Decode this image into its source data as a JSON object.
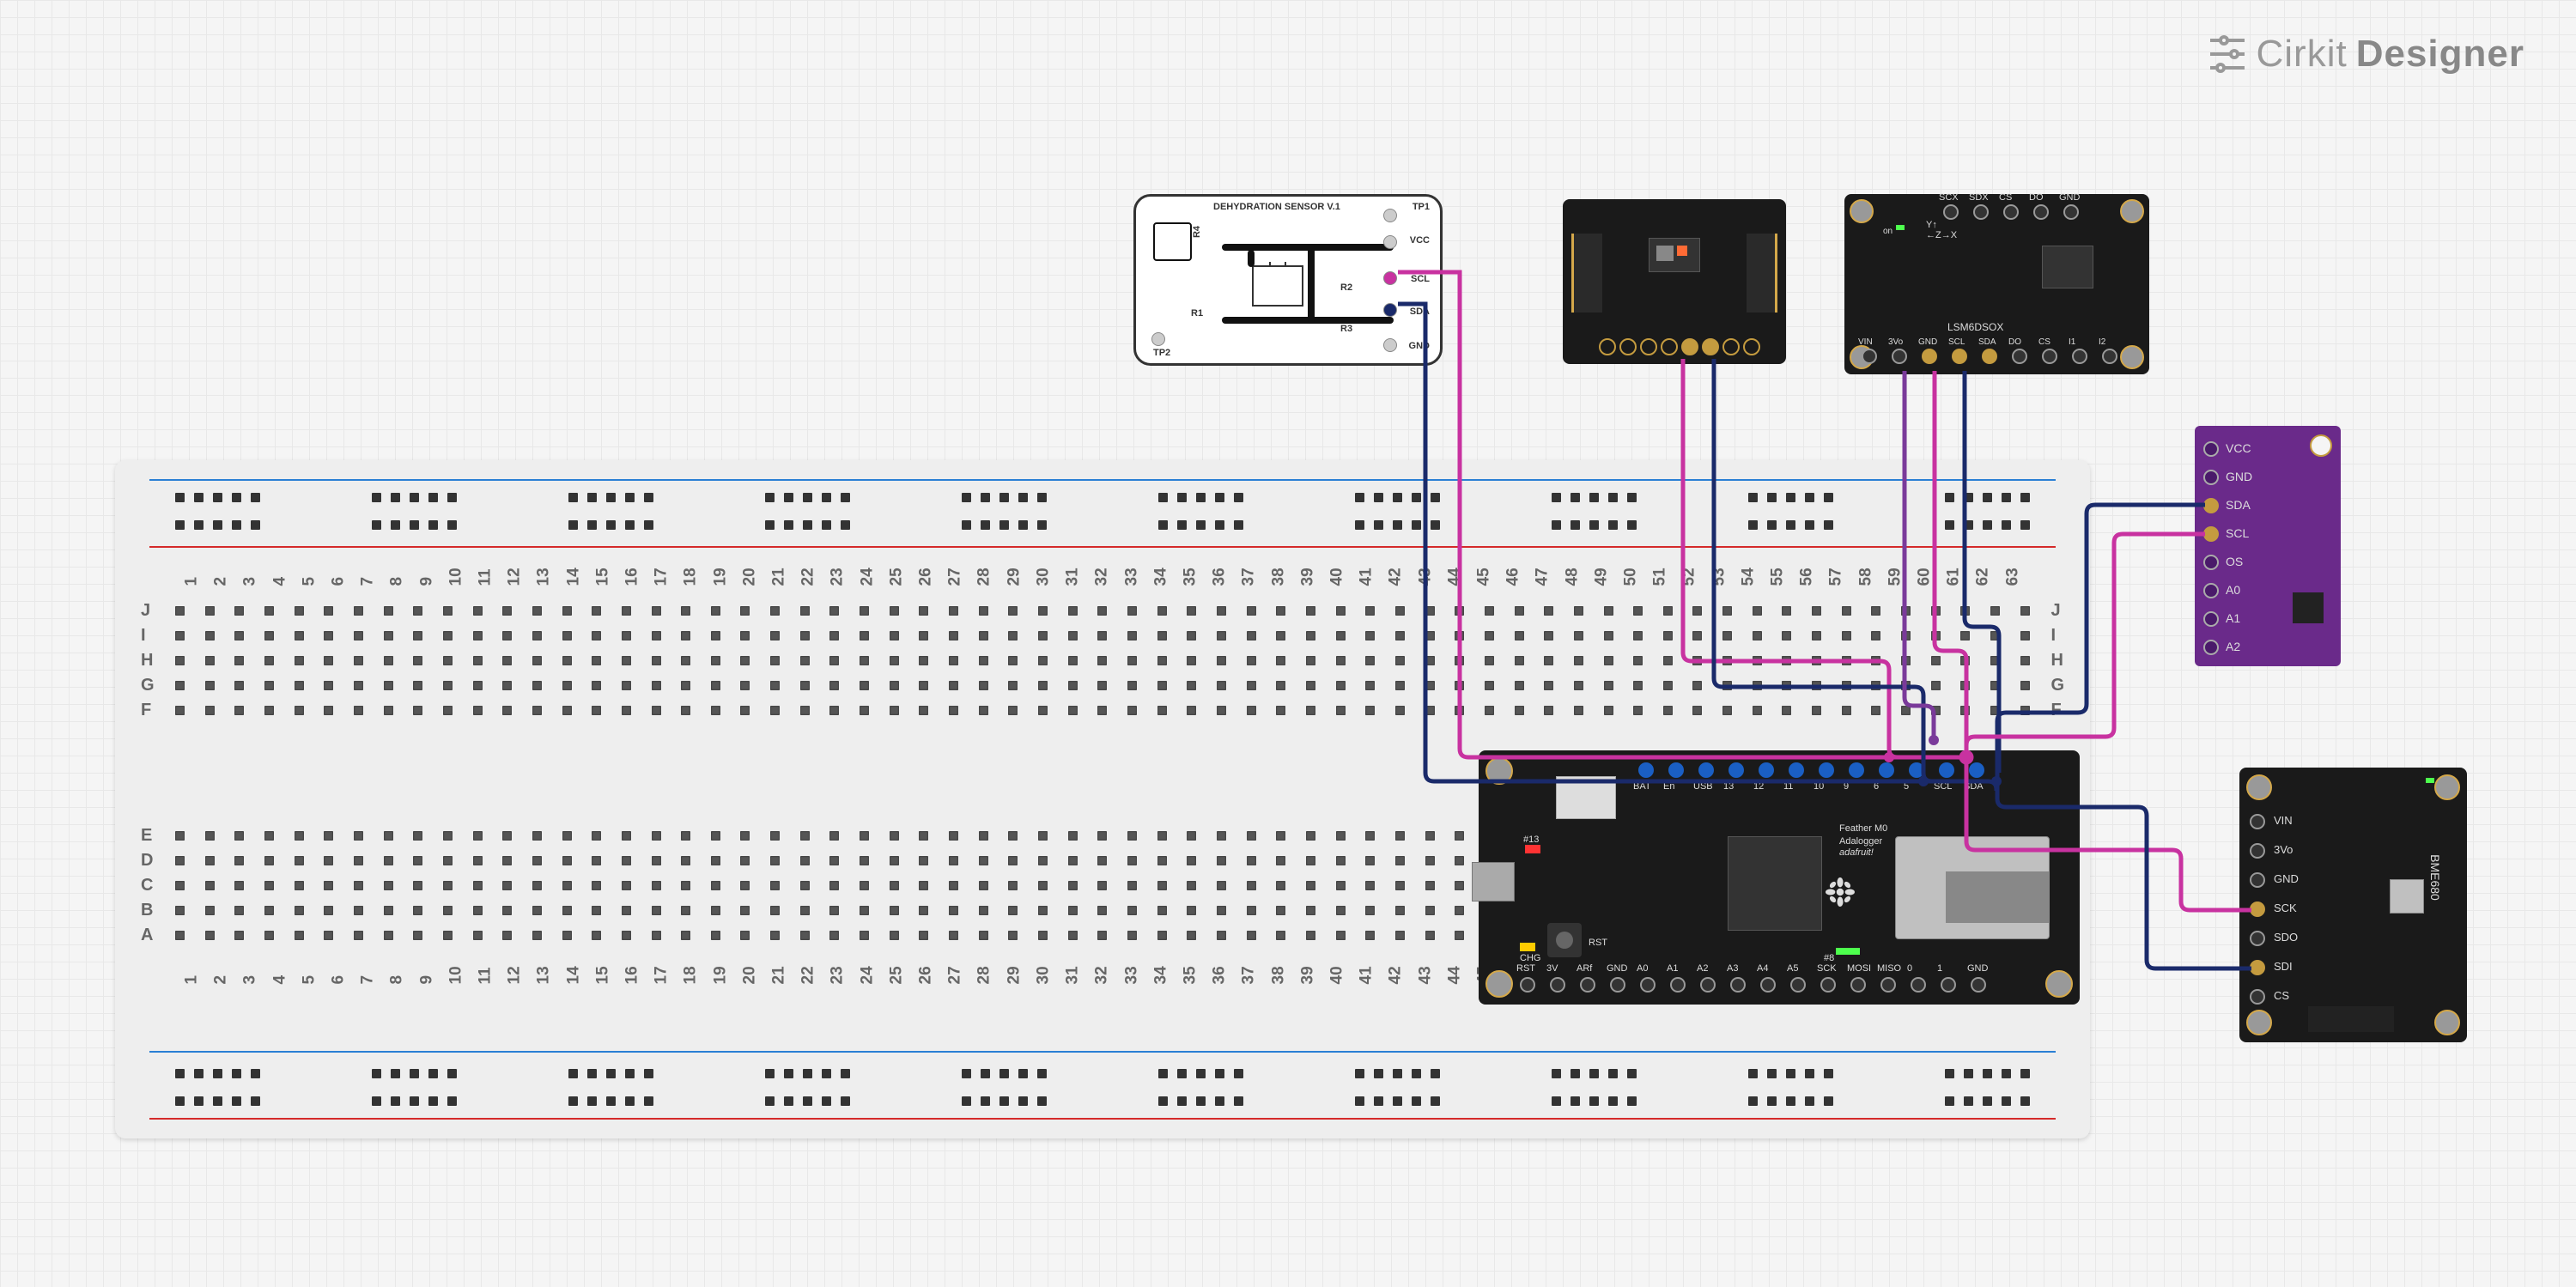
{
  "watermark": {
    "brand": "Cirkit",
    "suffix": "Designer"
  },
  "breadboard": {
    "rows_left": [
      "J",
      "I",
      "H",
      "G",
      "F"
    ],
    "rows_right": [
      "E",
      "D",
      "C",
      "B",
      "A"
    ],
    "columns": [
      "1",
      "2",
      "3",
      "4",
      "5",
      "6",
      "7",
      "8",
      "9",
      "10",
      "11",
      "12",
      "13",
      "14",
      "15",
      "16",
      "17",
      "18",
      "19",
      "20",
      "21",
      "22",
      "23",
      "24",
      "25",
      "26",
      "27",
      "28",
      "29",
      "30",
      "31",
      "32",
      "33",
      "34",
      "35",
      "36",
      "37",
      "38",
      "39",
      "40",
      "41",
      "42",
      "43",
      "44",
      "45",
      "46",
      "47",
      "48",
      "49",
      "50",
      "51",
      "52",
      "53",
      "54",
      "55",
      "56",
      "57",
      "58",
      "59",
      "60",
      "61",
      "62",
      "63"
    ]
  },
  "components": {
    "dehydration": {
      "title": "DEHYDRATION SENSOR V.1",
      "labels": {
        "tp1": "TP1",
        "tp2": "TP2",
        "vcc": "VCC",
        "scl": "SCL",
        "sda": "SDA",
        "gnd": "GND",
        "r1": "R1",
        "r2": "R2",
        "r3": "R3",
        "r4": "R4"
      }
    },
    "lsm": {
      "name": "LSM6DSOX",
      "top_pins": [
        "SCX",
        "SDX",
        "CS",
        "DO",
        "GND"
      ],
      "bottom_pins": [
        "VIN",
        "3Vo",
        "GND",
        "SCL",
        "SDA",
        "DO",
        "CS",
        "I1",
        "I2"
      ],
      "on": "on"
    },
    "purple": {
      "pins": [
        "VCC",
        "GND",
        "SDA",
        "SCL",
        "OS",
        "A0",
        "A1",
        "A2"
      ]
    },
    "bme": {
      "name": "BME680",
      "pins": [
        "VIN",
        "3Vo",
        "GND",
        "SCK",
        "SDO",
        "SDI",
        "CS"
      ]
    },
    "feather": {
      "name": "Feather M0",
      "sub": "Adalogger",
      "brand": "adafruit!",
      "top_pins": [
        "BAT",
        "En",
        "USB",
        "13",
        "12",
        "11",
        "10",
        "9",
        "6",
        "5",
        "SCL",
        "SDA"
      ],
      "bottom_pins": [
        "RST",
        "3V",
        "ARf",
        "GND",
        "A0",
        "A1",
        "A2",
        "A3",
        "A4",
        "A5",
        "SCK",
        "MOSI",
        "MISO",
        "0",
        "1",
        "GND"
      ],
      "labels": {
        "rst": "RST",
        "chg": "CHG",
        "thirteen": "#13",
        "eight": "#8"
      }
    }
  }
}
